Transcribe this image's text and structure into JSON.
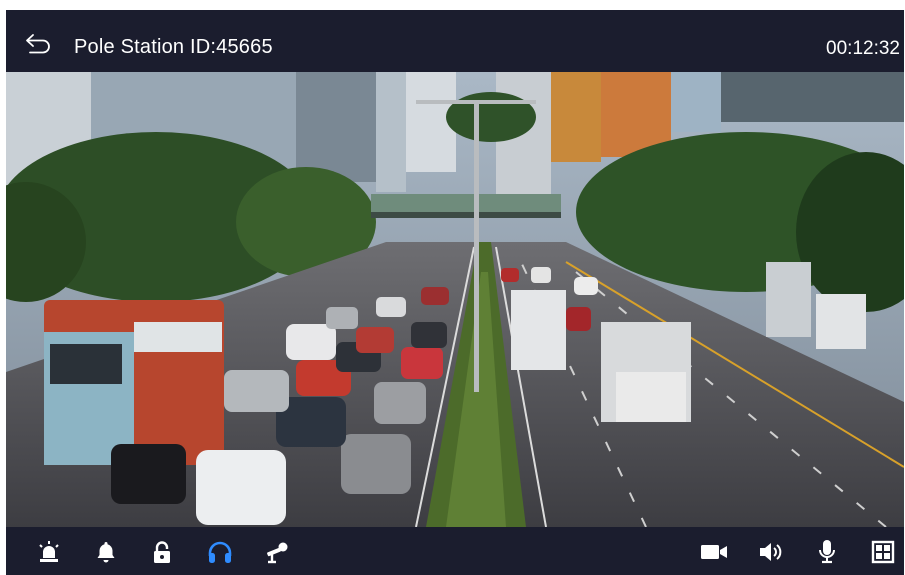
{
  "header": {
    "title": "Pole Station ID:45665",
    "clock": "00:12:32",
    "back_icon": "back-arrow-icon"
  },
  "video": {
    "content": "traffic-camera-feed"
  },
  "toolbar": {
    "left_icons": [
      "alarm-light-icon",
      "bell-icon",
      "lock-icon",
      "headphones-icon",
      "pole-camera-icon"
    ],
    "right_icons": [
      "video-camera-icon",
      "speaker-icon",
      "microphone-icon",
      "grid-layout-icon"
    ],
    "active_icon": "headphones-icon"
  },
  "colors": {
    "bar_background": "#1b1d2e",
    "icon": "#ffffff",
    "active_icon": "#2f8cff"
  }
}
